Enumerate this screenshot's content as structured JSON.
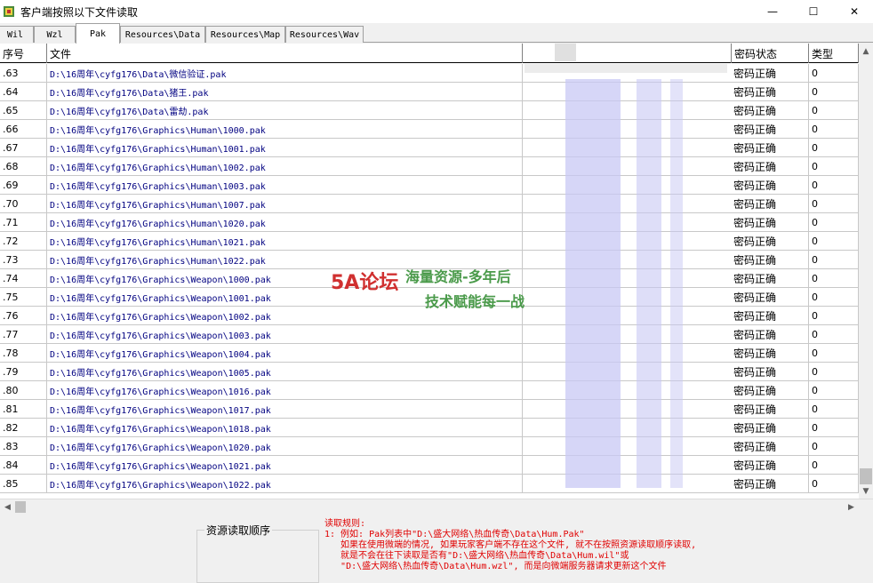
{
  "window": {
    "title": "客户端按照以下文件读取",
    "min_glyph": "—",
    "max_glyph": "☐",
    "close_glyph": "✕"
  },
  "tabs": [
    {
      "label": "Wil",
      "active": false
    },
    {
      "label": "Wzl",
      "active": false
    },
    {
      "label": "Pak",
      "active": true
    },
    {
      "label": "Resources\\Data",
      "active": false
    },
    {
      "label": "Resources\\Map",
      "active": false
    },
    {
      "label": "Resources\\Wav",
      "active": false
    }
  ],
  "grid": {
    "columns": [
      "序号",
      "文件",
      "密码状态",
      "类型"
    ],
    "rows": [
      {
        "num": ".63",
        "file": "D:\\16周年\\cyfg176\\Data\\微信验证.pak",
        "status": "密码正确",
        "type": "0"
      },
      {
        "num": ".64",
        "file": "D:\\16周年\\cyfg176\\Data\\猪王.pak",
        "status": "密码正确",
        "type": "0"
      },
      {
        "num": ".65",
        "file": "D:\\16周年\\cyfg176\\Data\\雷劫.pak",
        "status": "密码正确",
        "type": "0"
      },
      {
        "num": ".66",
        "file": "D:\\16周年\\cyfg176\\Graphics\\Human\\1000.pak",
        "status": "密码正确",
        "type": "0"
      },
      {
        "num": ".67",
        "file": "D:\\16周年\\cyfg176\\Graphics\\Human\\1001.pak",
        "status": "密码正确",
        "type": "0"
      },
      {
        "num": ".68",
        "file": "D:\\16周年\\cyfg176\\Graphics\\Human\\1002.pak",
        "status": "密码正确",
        "type": "0"
      },
      {
        "num": ".69",
        "file": "D:\\16周年\\cyfg176\\Graphics\\Human\\1003.pak",
        "status": "密码正确",
        "type": "0"
      },
      {
        "num": ".70",
        "file": "D:\\16周年\\cyfg176\\Graphics\\Human\\1007.pak",
        "status": "密码正确",
        "type": "0"
      },
      {
        "num": ".71",
        "file": "D:\\16周年\\cyfg176\\Graphics\\Human\\1020.pak",
        "status": "密码正确",
        "type": "0"
      },
      {
        "num": ".72",
        "file": "D:\\16周年\\cyfg176\\Graphics\\Human\\1021.pak",
        "status": "密码正确",
        "type": "0"
      },
      {
        "num": ".73",
        "file": "D:\\16周年\\cyfg176\\Graphics\\Human\\1022.pak",
        "status": "密码正确",
        "type": "0"
      },
      {
        "num": ".74",
        "file": "D:\\16周年\\cyfg176\\Graphics\\Weapon\\1000.pak",
        "status": "密码正确",
        "type": "0"
      },
      {
        "num": ".75",
        "file": "D:\\16周年\\cyfg176\\Graphics\\Weapon\\1001.pak",
        "status": "密码正确",
        "type": "0"
      },
      {
        "num": ".76",
        "file": "D:\\16周年\\cyfg176\\Graphics\\Weapon\\1002.pak",
        "status": "密码正确",
        "type": "0"
      },
      {
        "num": ".77",
        "file": "D:\\16周年\\cyfg176\\Graphics\\Weapon\\1003.pak",
        "status": "密码正确",
        "type": "0"
      },
      {
        "num": ".78",
        "file": "D:\\16周年\\cyfg176\\Graphics\\Weapon\\1004.pak",
        "status": "密码正确",
        "type": "0"
      },
      {
        "num": ".79",
        "file": "D:\\16周年\\cyfg176\\Graphics\\Weapon\\1005.pak",
        "status": "密码正确",
        "type": "0"
      },
      {
        "num": ".80",
        "file": "D:\\16周年\\cyfg176\\Graphics\\Weapon\\1016.pak",
        "status": "密码正确",
        "type": "0"
      },
      {
        "num": ".81",
        "file": "D:\\16周年\\cyfg176\\Graphics\\Weapon\\1017.pak",
        "status": "密码正确",
        "type": "0"
      },
      {
        "num": ".82",
        "file": "D:\\16周年\\cyfg176\\Graphics\\Weapon\\1018.pak",
        "status": "密码正确",
        "type": "0"
      },
      {
        "num": ".83",
        "file": "D:\\16周年\\cyfg176\\Graphics\\Weapon\\1020.pak",
        "status": "密码正确",
        "type": "0"
      },
      {
        "num": ".84",
        "file": "D:\\16周年\\cyfg176\\Graphics\\Weapon\\1021.pak",
        "status": "密码正确",
        "type": "0"
      },
      {
        "num": ".85",
        "file": "D:\\16周年\\cyfg176\\Graphics\\Weapon\\1022.pak",
        "status": "密码正确",
        "type": "0"
      }
    ]
  },
  "bottom": {
    "order_label": "资源读取顺序",
    "rules_lines": [
      "读取规则:",
      "1: 例如: Pak列表中\"D:\\盛大网络\\热血传奇\\Data\\Hum.Pak\"",
      "   如果在使用微端的情况, 如果玩家客户端不存在这个文件, 就不在按照资源读取顺序读取,",
      "   就是不会在往下读取是否有\"D:\\盛大网络\\热血传奇\\Data\\Hum.wil\"或",
      "   \"D:\\盛大网络\\热血传奇\\Data\\Hum.wzl\", 而是向微端服务器请求更新这个文件"
    ]
  },
  "watermark": {
    "logo": "5A论坛",
    "line1": "海量资源-多年后",
    "line2": "技术赋能每一战"
  },
  "scroll": {
    "up": "▲",
    "down": "▼",
    "left": "◀",
    "right": "▶"
  },
  "colors": {
    "file_text": "#000080",
    "rules_text": "#e00000",
    "blur": "#c8c8f4",
    "watermark_green": "#4a9a4a",
    "watermark_red": "#d03030"
  }
}
